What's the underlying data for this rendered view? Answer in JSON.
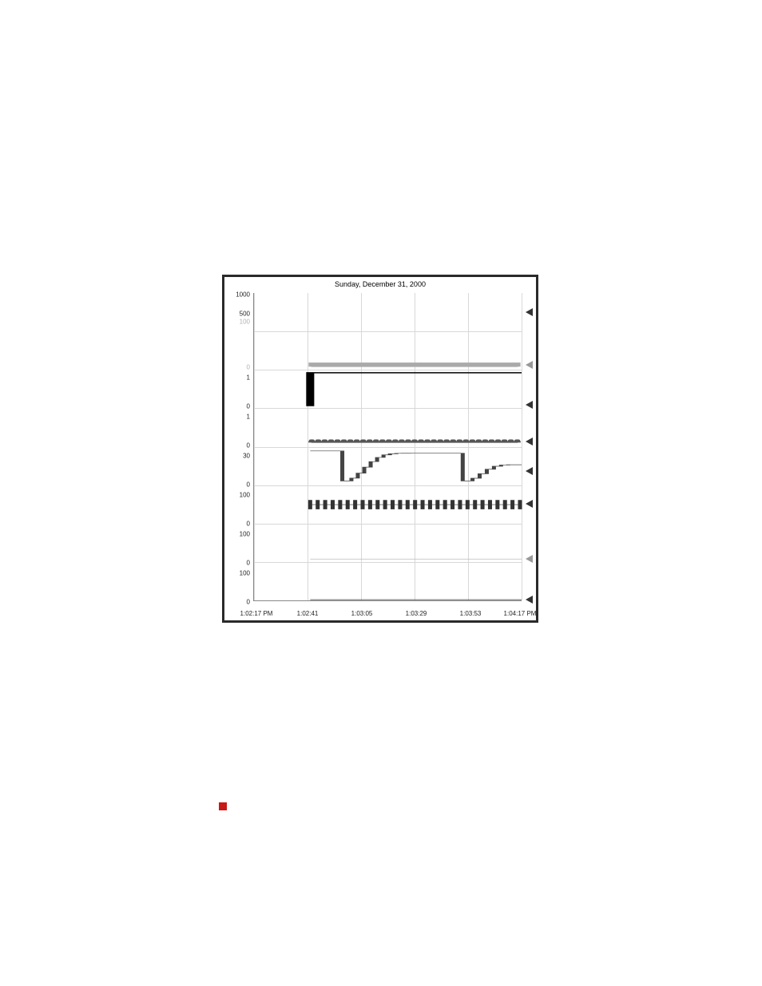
{
  "chart_data": {
    "type": "line",
    "title": "Sunday, December 31, 2000",
    "xlabel": "",
    "ylabel": "",
    "x_ticks": [
      "1:02:17 PM",
      "1:02:41",
      "1:03:05",
      "1:03:29",
      "1:03:53",
      "1:04:17 PM"
    ],
    "strips": [
      {
        "name": "strip-1",
        "y_ticks": [
          "1000",
          "500"
        ],
        "type": "flat",
        "value": 500,
        "range": [
          0,
          1000
        ]
      },
      {
        "name": "strip-2",
        "y_ticks": [
          "100",
          "0"
        ],
        "type": "pulse-small",
        "value": 10,
        "range": [
          0,
          100
        ],
        "faint": true
      },
      {
        "name": "strip-3",
        "y_ticks": [
          "1",
          "0"
        ],
        "type": "step-high",
        "value": 1,
        "range": [
          0,
          1
        ]
      },
      {
        "name": "strip-4",
        "y_ticks": [
          "1",
          "0"
        ],
        "type": "pulse-wave",
        "value": 0.1,
        "range": [
          0,
          1
        ]
      },
      {
        "name": "strip-5",
        "y_ticks": [
          "30",
          "0"
        ],
        "type": "sawtooth",
        "range": [
          0,
          30
        ],
        "series": [
          {
            "x": 0.33,
            "y": 30
          },
          {
            "x": 0.34,
            "y": 4
          },
          {
            "x": 0.58,
            "y": 28
          },
          {
            "x": 0.78,
            "y": 30
          },
          {
            "x": 0.79,
            "y": 4
          },
          {
            "x": 0.95,
            "y": 18
          }
        ]
      },
      {
        "name": "strip-6",
        "y_ticks": [
          "100",
          "0"
        ],
        "type": "tick-pulse",
        "value": 50,
        "range": [
          0,
          100
        ]
      },
      {
        "name": "strip-7",
        "y_ticks": [
          "100",
          "0"
        ],
        "type": "flat-low",
        "value": 5,
        "range": [
          0,
          100
        ]
      },
      {
        "name": "strip-8",
        "y_ticks": [
          "100",
          "0"
        ],
        "type": "flat-zero",
        "value": 0,
        "range": [
          0,
          100
        ]
      }
    ],
    "data_start_fraction": 0.21
  },
  "decoration": {
    "red_square": true
  }
}
